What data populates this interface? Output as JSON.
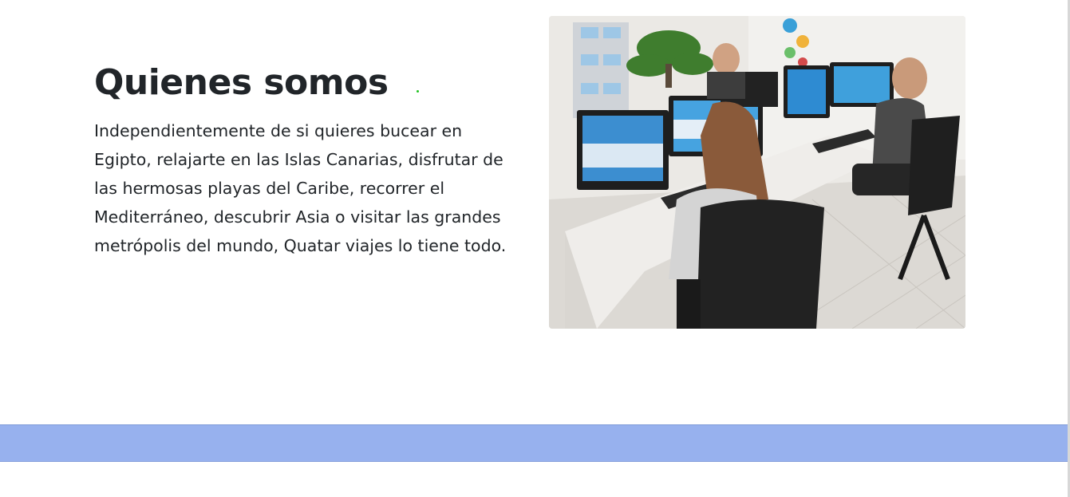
{
  "about": {
    "title": "Quienes somos",
    "description": "Independientemente de si quieres bucear en Egipto, relajarte en las Islas Canarias, disfrutar de las hermosas playas del Caribe, recorrer el Mediterráneo, descubrir Asia o visitar las grandes metrópolis del mundo, Quatar viajes lo tiene todo.",
    "image": {
      "alt": "Oficina de Quatar viajes con agentes trabajando en ordenadores",
      "icon": "office-photo"
    }
  },
  "colors": {
    "band": "#97b1ee",
    "text": "#212529",
    "accent_dot": "#22c322"
  }
}
